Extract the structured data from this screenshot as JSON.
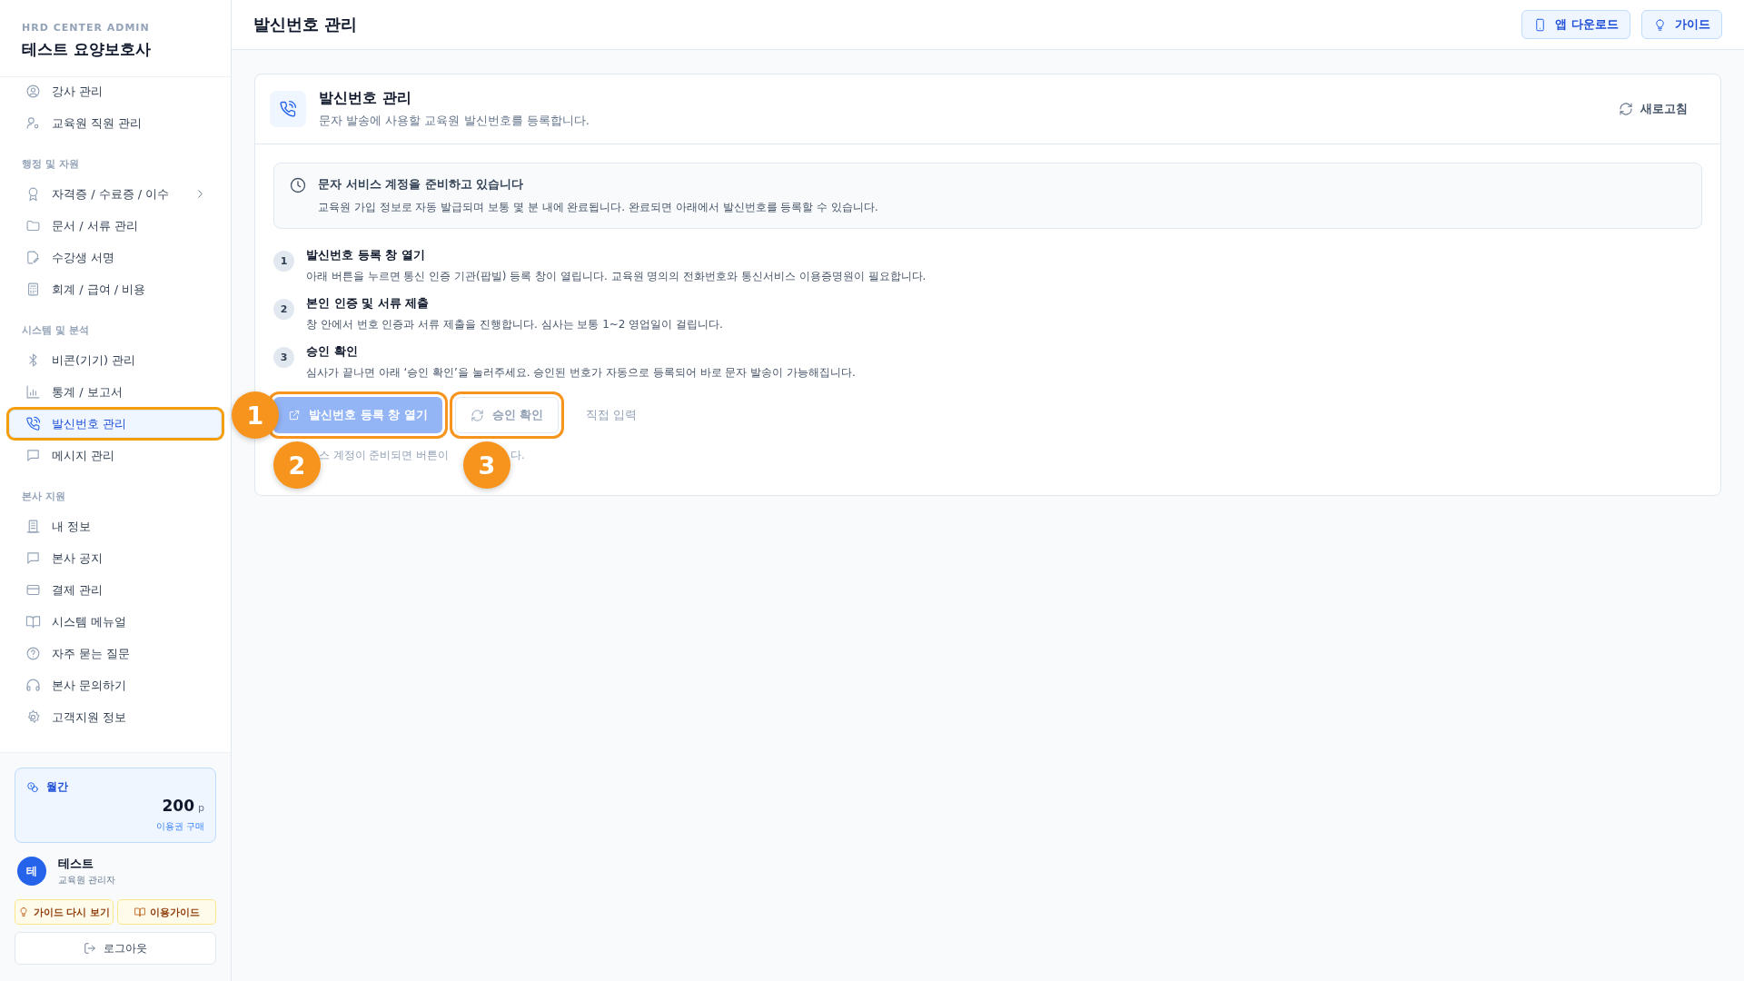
{
  "sidebar": {
    "brand": "HRD CENTER ADMIN",
    "org": "테스트 요양보호사",
    "nav": [
      {
        "kind": "item",
        "label": "강사 관리",
        "selected": false,
        "highlighted": false,
        "has_submenu": false
      },
      {
        "kind": "item",
        "label": "교육원 직원 관리",
        "selected": false,
        "highlighted": false,
        "has_submenu": false
      },
      {
        "kind": "section",
        "label": "행정 및 자원"
      },
      {
        "kind": "item",
        "label": "자격증 / 수료증 / 이수",
        "selected": false,
        "highlighted": false,
        "has_submenu": true
      },
      {
        "kind": "item",
        "label": "문서 / 서류 관리",
        "selected": false,
        "highlighted": false,
        "has_submenu": false
      },
      {
        "kind": "item",
        "label": "수강생 서명",
        "selected": false,
        "highlighted": false,
        "has_submenu": false
      },
      {
        "kind": "item",
        "label": "회계 / 급여 / 비용",
        "selected": false,
        "highlighted": false,
        "has_submenu": false
      },
      {
        "kind": "section",
        "label": "시스템 및 분석"
      },
      {
        "kind": "item",
        "label": "비콘(기기) 관리",
        "selected": false,
        "highlighted": false,
        "has_submenu": false
      },
      {
        "kind": "item",
        "label": "통계 / 보고서",
        "selected": false,
        "highlighted": false,
        "has_submenu": false
      },
      {
        "kind": "item",
        "label": "발신번호 관리",
        "selected": true,
        "highlighted": true,
        "has_submenu": false
      },
      {
        "kind": "item",
        "label": "메시지 관리",
        "selected": false,
        "highlighted": false,
        "has_submenu": false
      },
      {
        "kind": "section",
        "label": "본사 지원"
      },
      {
        "kind": "item",
        "label": "내 정보",
        "selected": false,
        "highlighted": false,
        "has_submenu": false
      },
      {
        "kind": "item",
        "label": "본사 공지",
        "selected": false,
        "highlighted": false,
        "has_submenu": false
      },
      {
        "kind": "item",
        "label": "결제 관리",
        "selected": false,
        "highlighted": false,
        "has_submenu": false
      },
      {
        "kind": "item",
        "label": "시스템 메뉴얼",
        "selected": false,
        "highlighted": false,
        "has_submenu": false
      },
      {
        "kind": "item",
        "label": "자주 묻는 질문",
        "selected": false,
        "highlighted": false,
        "has_submenu": false
      },
      {
        "kind": "item",
        "label": "본사 문의하기",
        "selected": false,
        "highlighted": false,
        "has_submenu": false
      },
      {
        "kind": "item",
        "label": "고객지원 정보",
        "selected": false,
        "highlighted": false,
        "has_submenu": false
      }
    ],
    "plan": {
      "label": "월간",
      "amount": "200",
      "unit": "p",
      "link": "이용권 구매"
    },
    "user": {
      "initial": "테",
      "name": "테스트",
      "role": "교육원 관리자"
    },
    "guide_buttons": [
      "가이드 다시 보기",
      "이용가이드"
    ],
    "logout": "로그아웃"
  },
  "header": {
    "title": "발신번호 관리",
    "buttons": [
      "앱 다운로드",
      "가이드"
    ]
  },
  "card": {
    "title": "발신번호 관리",
    "subtitle": "문자 발송에 사용할 교육원 발신번호를 등록합니다.",
    "refresh": "새로고침",
    "notice": {
      "title": "문자 서비스 계정을 준비하고 있습니다",
      "text": "교육원 가입 정보로 자동 발급되며 보통 몇 분 내에 완료됩니다. 완료되면 아래에서 발신번호를 등록할 수 있습니다."
    },
    "steps": [
      {
        "number": "1",
        "title": "발신번호 등록 창 열기",
        "text": "아래 버튼을 누르면 통신 인증 기관(팝빌) 등록 창이 열립니다. 교육원 명의의 전화번호와 통신서비스 이용증명원이 필요합니다."
      },
      {
        "number": "2",
        "title": "본인 인증 및 서류 제출",
        "text": "창 안에서 번호 인증과 서류 제출을 진행합니다. 심사는 보통 1~2 영업일이 걸립니다."
      },
      {
        "number": "3",
        "title": "승인 확인",
        "text": "심사가 끝나면 아래 ‘승인 확인’을 눌러주세요. 승인된 번호가 자동으로 등록되어 바로 문자 발송이 가능해집니다."
      }
    ],
    "actions": [
      {
        "kind": "primary",
        "label": "발신번호 등록 창 열기",
        "disabled": true,
        "highlighted": true
      },
      {
        "kind": "outline",
        "label": "승인 확인",
        "disabled": true,
        "highlighted": true
      },
      {
        "kind": "text",
        "label": "직접 입력",
        "disabled": true,
        "highlighted": false
      }
    ],
    "note_parts": [
      "스 계정이 준비되면 버튼이",
      "다."
    ]
  },
  "tour_markers": [
    {
      "label": "1"
    },
    {
      "label": "2"
    },
    {
      "label": "3"
    }
  ]
}
